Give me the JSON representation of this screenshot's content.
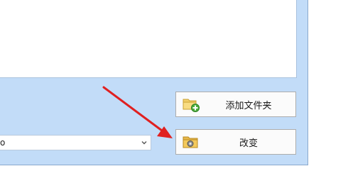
{
  "buttons": {
    "add_folder": {
      "label": "添加文件夹",
      "icon": "folder-add-icon"
    },
    "change": {
      "label": "改变",
      "icon": "folder-gear-icon"
    }
  },
  "dropdown": {
    "value": "o",
    "icon": "chevron-down-icon"
  },
  "annotation": {
    "color": "#e02020"
  },
  "colors": {
    "dialog_bg": "#c2dcf8",
    "list_bg": "#ffffff"
  }
}
